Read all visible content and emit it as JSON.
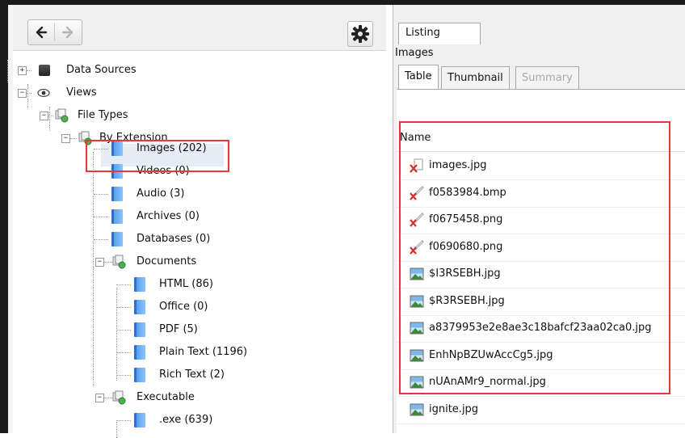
{
  "toolbar": {
    "back_icon": "arrow-left-icon",
    "forward_icon": "arrow-right-icon",
    "settings_icon": "gear-icon"
  },
  "tree": [
    {
      "label": "Data Sources",
      "icon": "drive-icon",
      "expander": "+"
    },
    {
      "label": "Views",
      "icon": "eye-icon",
      "expander": "-"
    },
    {
      "label": "File Types",
      "icon": "filetype-icon",
      "expander": "-"
    },
    {
      "label": "By Extension",
      "icon": "filetype-icon",
      "expander": "-"
    },
    {
      "label": "Images (202)",
      "icon": "file-icon",
      "selected": true
    },
    {
      "label": "Videos (0)",
      "icon": "file-icon"
    },
    {
      "label": "Audio (3)",
      "icon": "file-icon"
    },
    {
      "label": "Archives (0)",
      "icon": "file-icon"
    },
    {
      "label": "Databases (0)",
      "icon": "file-icon"
    },
    {
      "label": "Documents",
      "icon": "filetype-icon",
      "expander": "-"
    },
    {
      "label": "HTML (86)",
      "icon": "file-icon"
    },
    {
      "label": "Office (0)",
      "icon": "file-icon"
    },
    {
      "label": "PDF (5)",
      "icon": "file-icon"
    },
    {
      "label": "Plain Text (1196)",
      "icon": "file-icon"
    },
    {
      "label": "Rich Text (2)",
      "icon": "file-icon"
    },
    {
      "label": "Executable",
      "icon": "filetype-icon",
      "expander": "-"
    },
    {
      "label": ".exe (639)",
      "icon": "file-icon"
    }
  ],
  "right": {
    "listing_tab": "Listing",
    "section_label": "Images",
    "subtabs": [
      "Table",
      "Thumbnail",
      "Summary"
    ],
    "column_name": "Name",
    "files": [
      {
        "name": "images.jpg",
        "icon": "deleted-file-icon"
      },
      {
        "name": "f0583984.bmp",
        "icon": "deleted-carved-file-icon"
      },
      {
        "name": "f0675458.png",
        "icon": "deleted-carved-file-icon"
      },
      {
        "name": "f0690680.png",
        "icon": "deleted-carved-file-icon"
      },
      {
        "name": "$I3RSEBH.jpg",
        "icon": "image-file-icon"
      },
      {
        "name": "$R3RSEBH.jpg",
        "icon": "image-file-icon"
      },
      {
        "name": "a8379953e2e8ae3c18bafcf23aa02ca0.jpg",
        "icon": "image-file-icon"
      },
      {
        "name": "EnhNpBZUwAccCg5.jpg",
        "icon": "image-file-icon"
      },
      {
        "name": "nUAnAMr9_normal.jpg",
        "icon": "image-file-icon"
      },
      {
        "name": "ignite.jpg",
        "icon": "image-file-icon"
      }
    ]
  },
  "colors": {
    "highlight_box": "#e53935",
    "selection": "#e5ecf6"
  }
}
